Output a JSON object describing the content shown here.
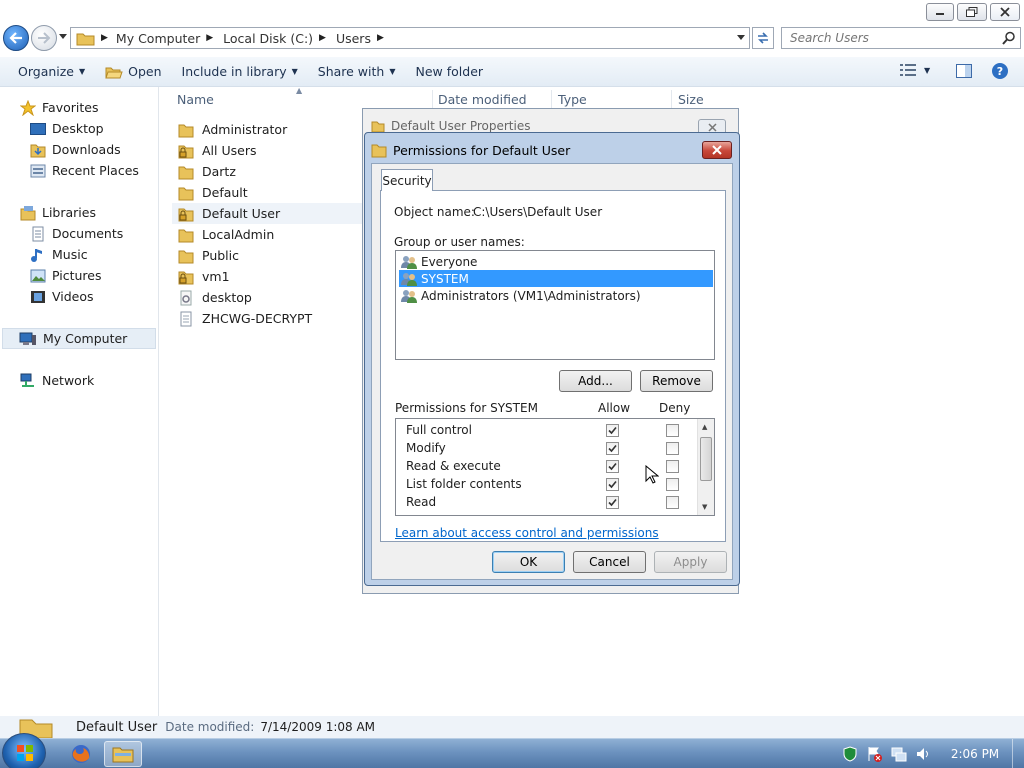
{
  "explorer": {
    "breadcrumbs": [
      "My Computer",
      "Local Disk (C:)",
      "Users"
    ],
    "search_placeholder": "Search Users",
    "toolbar": {
      "organize": "Organize",
      "open": "Open",
      "include_in_library": "Include in library",
      "share_with": "Share with",
      "new_folder": "New folder"
    },
    "nav": {
      "favorites": "Favorites",
      "desktop": "Desktop",
      "downloads": "Downloads",
      "recent_places": "Recent Places",
      "libraries": "Libraries",
      "documents": "Documents",
      "music": "Music",
      "pictures": "Pictures",
      "videos": "Videos",
      "my_computer": "My Computer",
      "network": "Network"
    },
    "columns": {
      "name": "Name",
      "date_modified": "Date modified",
      "type": "Type",
      "size": "Size"
    },
    "files": [
      {
        "name": "Administrator",
        "icon": "folder-icon"
      },
      {
        "name": "All Users",
        "icon": "locked-folder-icon"
      },
      {
        "name": "Dartz",
        "icon": "folder-icon"
      },
      {
        "name": "Default",
        "icon": "folder-icon"
      },
      {
        "name": "Default User",
        "icon": "locked-folder-icon"
      },
      {
        "name": "LocalAdmin",
        "icon": "folder-icon"
      },
      {
        "name": "Public",
        "icon": "folder-icon"
      },
      {
        "name": "vm1",
        "icon": "locked-folder-icon"
      },
      {
        "name": "desktop",
        "icon": "settings-file-icon"
      },
      {
        "name": "ZHCWG-DECRYPT",
        "icon": "text-file-icon"
      }
    ],
    "status": {
      "name": "Default User",
      "date_label": "Date modified:",
      "date_value": "7/14/2009 1:08 AM"
    }
  },
  "properties_dialog": {
    "title": "Default User Properties"
  },
  "permissions_dialog": {
    "title": "Permissions for Default User",
    "tab": "Security",
    "object_name_label": "Object name:",
    "object_name_value": "C:\\Users\\Default User",
    "group_label": "Group or user names:",
    "users": [
      {
        "name": "Everyone",
        "selected": false
      },
      {
        "name": "SYSTEM",
        "selected": true
      },
      {
        "name": "Administrators (VM1\\Administrators)",
        "selected": false
      }
    ],
    "add_button": "Add...",
    "remove_button": "Remove",
    "permissions_label": "Permissions for SYSTEM",
    "allow_header": "Allow",
    "deny_header": "Deny",
    "permissions": [
      {
        "name": "Full control",
        "allow": true,
        "deny": false
      },
      {
        "name": "Modify",
        "allow": true,
        "deny": false
      },
      {
        "name": "Read & execute",
        "allow": true,
        "deny": false
      },
      {
        "name": "List folder contents",
        "allow": true,
        "deny": false
      },
      {
        "name": "Read",
        "allow": true,
        "deny": false
      }
    ],
    "learn_link": "Learn about access control and permissions",
    "ok_button": "OK",
    "cancel_button": "Cancel",
    "apply_button": "Apply"
  },
  "taskbar": {
    "clock": "2:06 PM"
  },
  "colors": {
    "selection": "#3399ff",
    "link": "#0066cc",
    "toolbar_text": "#1e3250",
    "close_red": "#c8473a"
  }
}
